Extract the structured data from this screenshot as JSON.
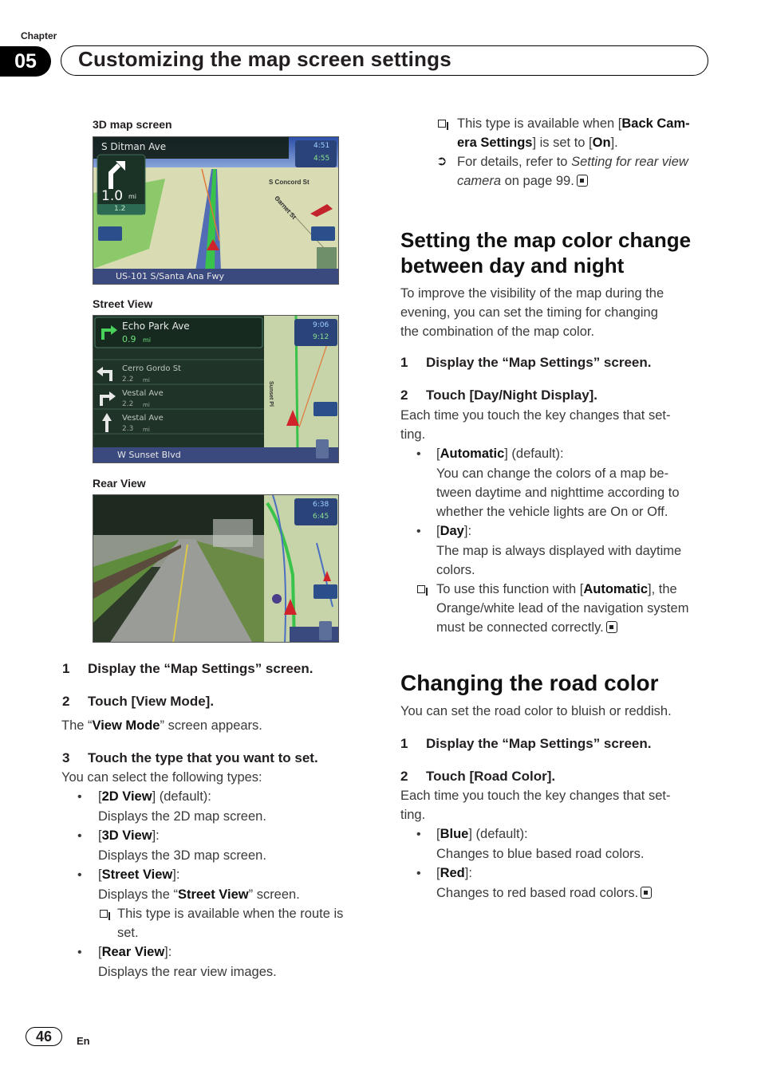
{
  "header": {
    "chapter_label": "Chapter",
    "chapter_number": "05",
    "chapter_title": "Customizing the map screen settings"
  },
  "screens": {
    "map3d": {
      "caption": "3D map screen",
      "street": "S Ditman Ave",
      "distance": "1.0",
      "distance_unit": "mi",
      "next_distance": "1.2",
      "time1": "4:51",
      "time2": "4:55",
      "label_concord": "S Concord St",
      "label_garnet": "Garnet St",
      "bottom_road": "US-101 S/Santa Ana Fwy",
      "ipod_label": "iPod"
    },
    "street_view": {
      "caption": "Street View",
      "items": [
        {
          "street": "Echo Park Ave",
          "distance": "0.9",
          "unit": "mi",
          "icon": "turn-right-icon"
        },
        {
          "street": "Cerro Gordo St",
          "distance": "2.2",
          "unit": "mi",
          "icon": "turn-left-icon"
        },
        {
          "street": "Vestal Ave",
          "distance": "2.2",
          "unit": "mi",
          "icon": "turn-right-icon"
        },
        {
          "street": "Vestal Ave",
          "distance": "2.3",
          "unit": "mi",
          "icon": "straight-icon"
        }
      ],
      "time1": "9:06",
      "time2": "9:12",
      "map_label": "Sunset Pl",
      "bottom_road": "W Sunset Blvd",
      "ipod_label": "iPod"
    },
    "rear_view": {
      "caption": "Rear View",
      "time1": "6:38",
      "time2": "6:45",
      "ipod_label": "iPod"
    }
  },
  "left_column": {
    "step1": {
      "n": "1",
      "text": "Display the “Map Settings” screen."
    },
    "step2": {
      "n": "2",
      "text": "Touch [View Mode]."
    },
    "step2_desc_pre": "The “",
    "step2_desc_bold": "View Mode",
    "step2_desc_post": "” screen appears.",
    "step3": {
      "n": "3",
      "text": "Touch the type that you want to set."
    },
    "step3_desc": "You can select the following types:",
    "options": [
      {
        "name": "2D View",
        "suffix": "] (default):",
        "desc": "Displays the 2D map screen."
      },
      {
        "name": "3D View",
        "suffix": "]:",
        "desc": "Displays the 3D map screen."
      },
      {
        "name": "Street View",
        "suffix": "]:",
        "desc_pre": "Displays the “",
        "desc_bold": "Street View",
        "desc_post": "” screen."
      },
      {
        "name": "Rear View",
        "suffix": "]:",
        "desc": "Displays the rear view images."
      }
    ],
    "street_note_line1": "This type is available when the route is",
    "street_note_line2": "set."
  },
  "right_column": {
    "rear_note_line1_pre": "This type is available when [",
    "rear_note_line1_bold": "Back Cam-",
    "rear_note_line2_bold": "era Settings",
    "rear_note_line2_mid": "] is set to [",
    "rear_note_line2_bold2": "On",
    "rear_note_line2_post": "].",
    "ref_line1_pre": "For details, refer to ",
    "ref_line1_italic": "Setting for rear view",
    "ref_line2_italic": "camera",
    "ref_line2_post": " on page 99.",
    "section1": {
      "title_line1": "Setting the map color change",
      "title_line2": "between day and night",
      "intro": [
        "To improve the visibility of the map during the",
        "evening, you can set the timing for changing",
        "the combination of the map color."
      ],
      "step1": {
        "n": "1",
        "text": "Display the “Map Settings” screen."
      },
      "step2": {
        "n": "2",
        "text": "Touch [Day/Night Display]."
      },
      "step2_desc": [
        "Each time you touch the key changes that set-",
        "ting."
      ],
      "opt1_name": "Automatic",
      "opt1_suffix": "] (default):",
      "opt1_desc": [
        "You can change the colors of a map be-",
        "tween daytime and nighttime according to",
        "whether the vehicle lights are On or Off."
      ],
      "opt2_name": "Day",
      "opt2_suffix": "]:",
      "opt2_desc": [
        "The map is always displayed with daytime",
        "colors."
      ],
      "note_pre": "To use this function with [",
      "note_bold": "Automatic",
      "note_post": "], the",
      "note_line2": "Orange/white lead of the navigation system",
      "note_line3": "must be connected correctly."
    },
    "section2": {
      "title": "Changing the road color",
      "intro": "You can set the road color to bluish or reddish.",
      "step1": {
        "n": "1",
        "text": "Display the “Map Settings” screen."
      },
      "step2": {
        "n": "2",
        "text": "Touch [Road Color]."
      },
      "step2_desc": [
        "Each time you touch the key changes that set-",
        "ting."
      ],
      "opt1_name": "Blue",
      "opt1_suffix": "] (default):",
      "opt1_desc": "Changes to blue based road colors.",
      "opt2_name": "Red",
      "opt2_suffix": "]:",
      "opt2_desc": "Changes to red based road colors."
    }
  },
  "footer": {
    "page_number": "46",
    "language": "En"
  }
}
